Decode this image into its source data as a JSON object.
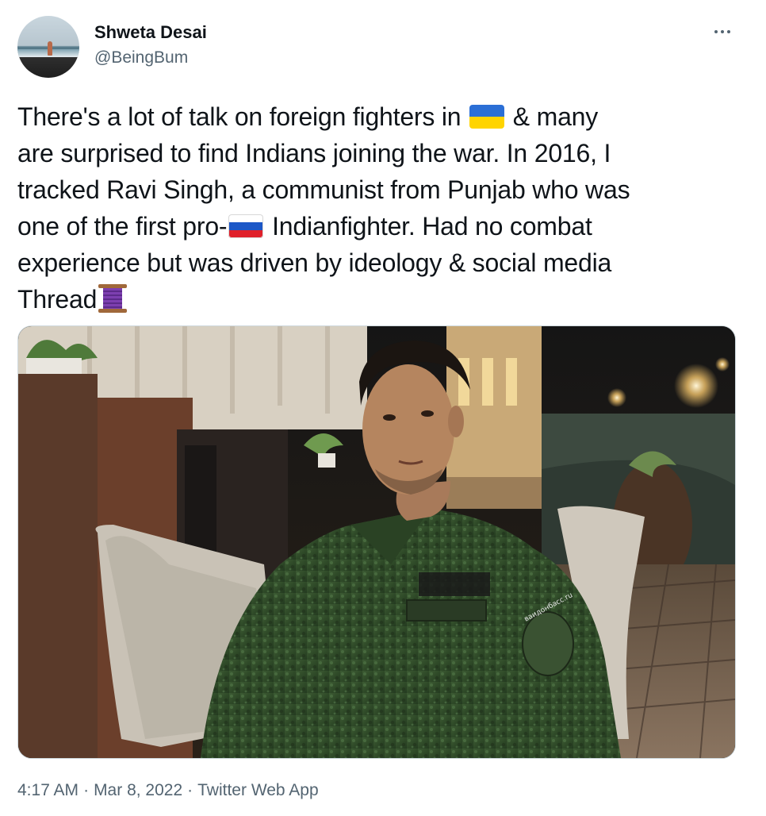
{
  "author": {
    "name": "Shweta Desai",
    "handle": "@BeingBum",
    "avatar_icon": "beach-avatar"
  },
  "more_icon": "more-dots-icon",
  "tweet": {
    "lines": [
      [
        "There's a lot of talk on foreign fighters in ",
        "& many"
      ],
      "are surprised to find Indians joining the war. In 2016, I",
      "tracked Ravi Singh, a communist from Punjab who was",
      [
        "one of the first pro-",
        "Indianfighter. Had no combat"
      ],
      "experience but was driven by ideology & social media",
      "Thread"
    ],
    "emoji": {
      "ukraine_flag": "ukraine-flag-emoji",
      "russia_flag": "russia-flag-emoji",
      "thread": "thread-spool-emoji"
    }
  },
  "media": {
    "kind": "photo",
    "patch_text": "ваидонбасс.ru"
  },
  "meta": {
    "time": "4:17 AM",
    "date": "Mar 8, 2022",
    "source": "Twitter Web App",
    "separator": "·"
  }
}
